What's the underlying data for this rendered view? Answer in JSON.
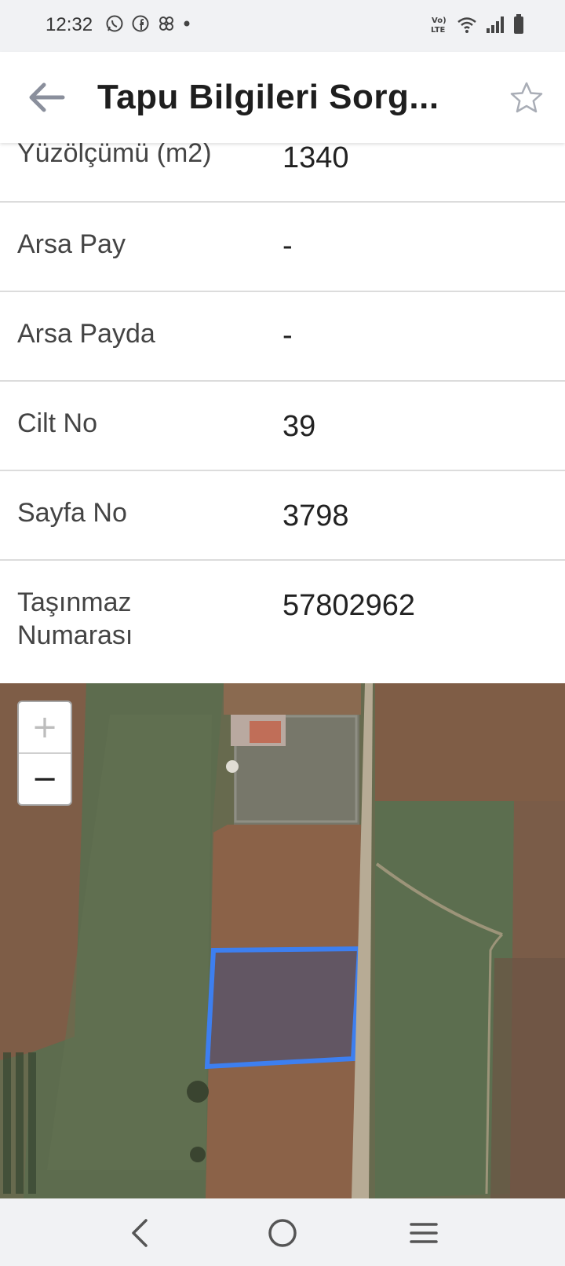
{
  "status_bar": {
    "time": "12:32",
    "left_icons": [
      "whatsapp-icon",
      "facebook-icon",
      "pinwheel-icon",
      "dot-icon"
    ],
    "right_icons": [
      "volte-icon",
      "wifi-icon",
      "signal-icon",
      "battery-icon"
    ],
    "volte_text": "VoLTE"
  },
  "app_bar": {
    "title": "Tapu Bilgileri Sorg...",
    "back_icon": "arrow-left-icon",
    "favorite_icon": "star-outline-icon"
  },
  "info_rows": [
    {
      "label": "Yüzölçümü (m2)",
      "value": "1340"
    },
    {
      "label": "Arsa Pay",
      "value": "-"
    },
    {
      "label": "Arsa Payda",
      "value": "-"
    },
    {
      "label": "Cilt No",
      "value": "39"
    },
    {
      "label": "Sayfa No",
      "value": "3798"
    },
    {
      "label": "Taşınmaz Numarası",
      "value": "57802962"
    }
  ],
  "map": {
    "zoom_in_label": "+",
    "zoom_out_label": "−",
    "parcel_outline_color": "#3d7ff0"
  },
  "nav_bar": {
    "icons": [
      "back-nav-icon",
      "home-nav-icon",
      "recents-nav-icon"
    ]
  }
}
